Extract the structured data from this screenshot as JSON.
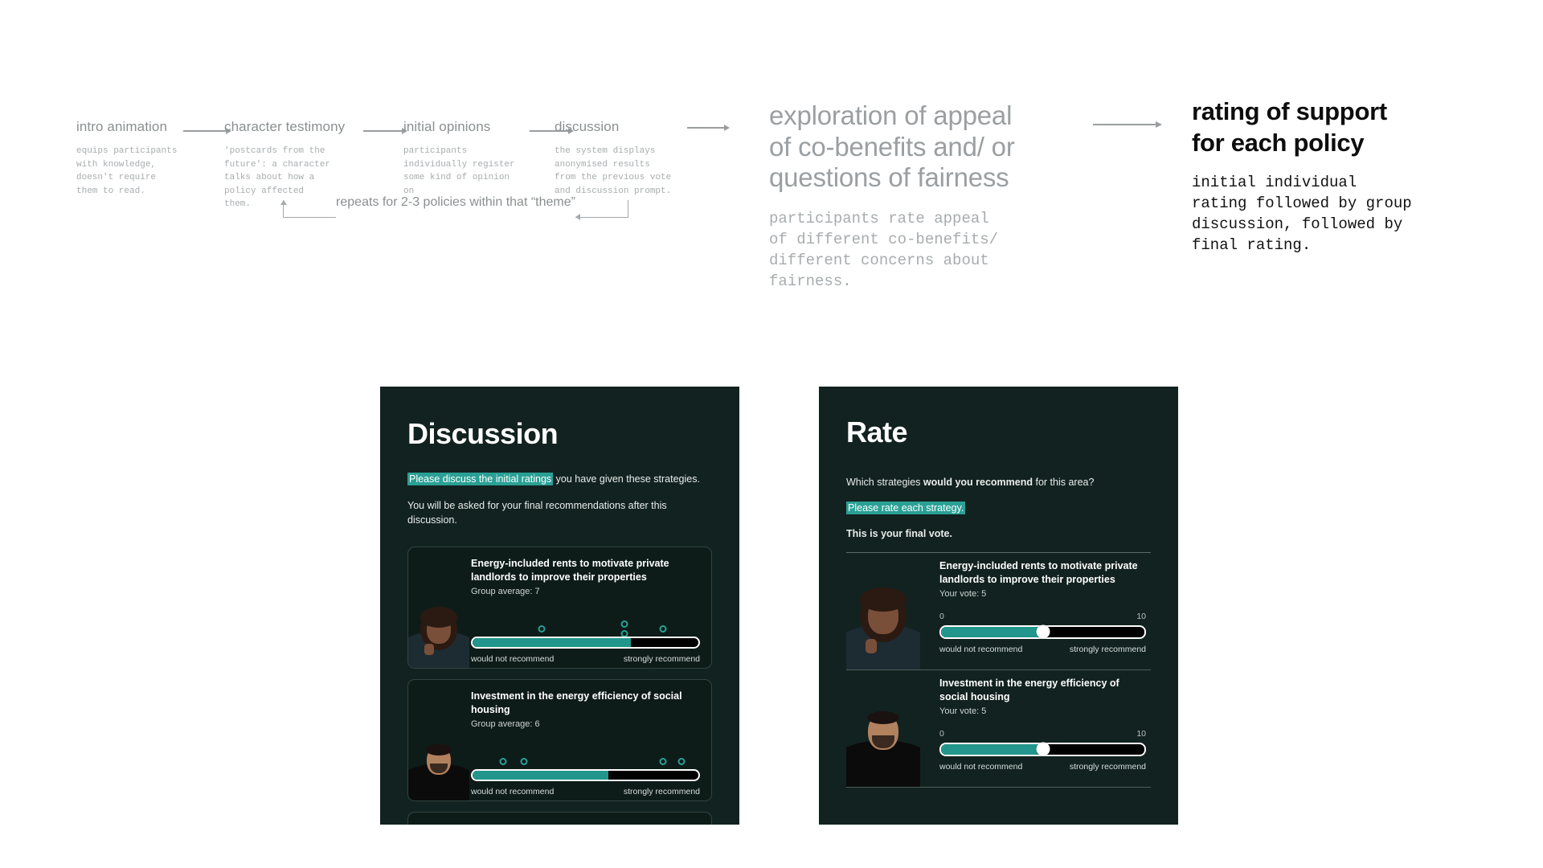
{
  "flow": {
    "steps": [
      {
        "title": "intro animation",
        "desc": "equips participants\nwith knowledge,\ndoesn't require\nthem to read."
      },
      {
        "title": "character testimony",
        "desc": "'postcards from the\nfuture': a character\ntalks about how a\npolicy affected them."
      },
      {
        "title": "initial opinions",
        "desc": "participants\nindividually register\nsome kind of opinion on\nwhat they just heard."
      },
      {
        "title": "discussion",
        "desc": "the system displays\nanonymised results\nfrom the previous vote\nand discussion prompt."
      }
    ],
    "repeat_label": "repeats for 2-3 policies within that “theme”",
    "big_steps": [
      {
        "title": "exploration of appeal\nof co-benefits and/ or\nquestions of fairness",
        "desc": "participants rate appeal\nof different co-benefits/\ndifferent concerns about\nfairness."
      },
      {
        "title": "rating of support\nfor each policy",
        "desc": "initial individual\nrating followed by group\ndiscussion, followed by\nfinal rating."
      }
    ]
  },
  "colors": {
    "panel_bg": "#122220",
    "card_bg": "#0e1c19",
    "accent": "#2aa095",
    "fill": "#22968c",
    "track": "#000000",
    "grey_text": "#9b9fa1"
  },
  "discussion_screen": {
    "title": "Discussion",
    "intro_highlight": "Please discuss the initial ratings",
    "intro_rest": " you have given these strategies.",
    "secondary": "You will be asked for your final recommendations after this discussion.",
    "bar_left_label": "would not recommend",
    "bar_right_label": "strongly recommend",
    "cards": [
      {
        "title": "Energy-included rents to motivate private landlords to improve their properties",
        "subtitle": "Group average: 7",
        "fill_percent": 70,
        "dots": [
          31,
          67,
          67,
          84
        ],
        "dot_offsets": [
          0,
          -8,
          8,
          0
        ],
        "portrait": "woman-curly-hair-portrait"
      },
      {
        "title": "Investment in the energy efficiency of social housing",
        "subtitle": "Group average: 6",
        "fill_percent": 60,
        "dots": [
          14,
          23,
          84,
          92
        ],
        "dot_offsets": [
          0,
          0,
          0,
          0
        ],
        "portrait": "man-beard-portrait"
      }
    ]
  },
  "rate_screen": {
    "title": "Rate",
    "question_pre": "Which strategies ",
    "question_bold": "would you recommend",
    "question_post": " for this area?",
    "instruction_highlight": "Please rate each strategy.",
    "final_vote_note": "This is your final vote.",
    "scale_min": "0",
    "scale_max": "10",
    "bar_left_label": "would not recommend",
    "bar_right_label": "strongly recommend",
    "rows": [
      {
        "title": "Energy-included rents to motivate private landlords to improve their properties",
        "subtitle": "Your vote: 5",
        "value_percent": 50,
        "portrait": "woman-curly-hair-portrait"
      },
      {
        "title": "Investment in the energy efficiency of social housing",
        "subtitle": "Your vote: 5",
        "value_percent": 50,
        "portrait": "man-beard-portrait"
      }
    ]
  }
}
